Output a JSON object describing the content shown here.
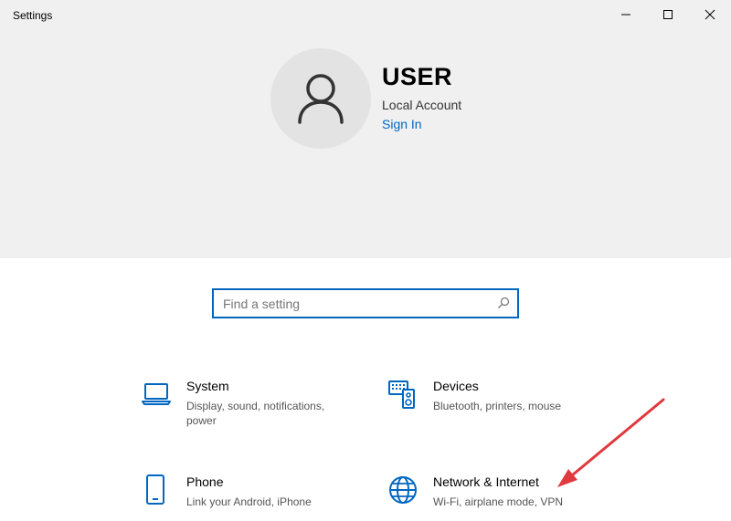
{
  "window": {
    "title": "Settings",
    "minimize_icon": "minimize-icon",
    "maximize_icon": "maximize-icon",
    "close_icon": "close-icon"
  },
  "account": {
    "name": "USER",
    "type": "Local Account",
    "sign_in": "Sign In",
    "avatar_icon": "person-icon"
  },
  "search": {
    "placeholder": "Find a setting",
    "value": "",
    "icon": "search-icon"
  },
  "tiles": [
    {
      "title": "System",
      "description": "Display, sound, notifications, power",
      "icon": "laptop-icon"
    },
    {
      "title": "Devices",
      "description": "Bluetooth, printers, mouse",
      "icon": "devices-icon"
    },
    {
      "title": "Phone",
      "description": "Link your Android, iPhone",
      "icon": "phone-icon"
    },
    {
      "title": "Network & Internet",
      "description": "Wi-Fi, airplane mode, VPN",
      "icon": "globe-icon"
    }
  ],
  "colors": {
    "accent": "#0067c0",
    "hero_background": "#f0f0f0",
    "annotation_arrow": "#e0393e"
  }
}
